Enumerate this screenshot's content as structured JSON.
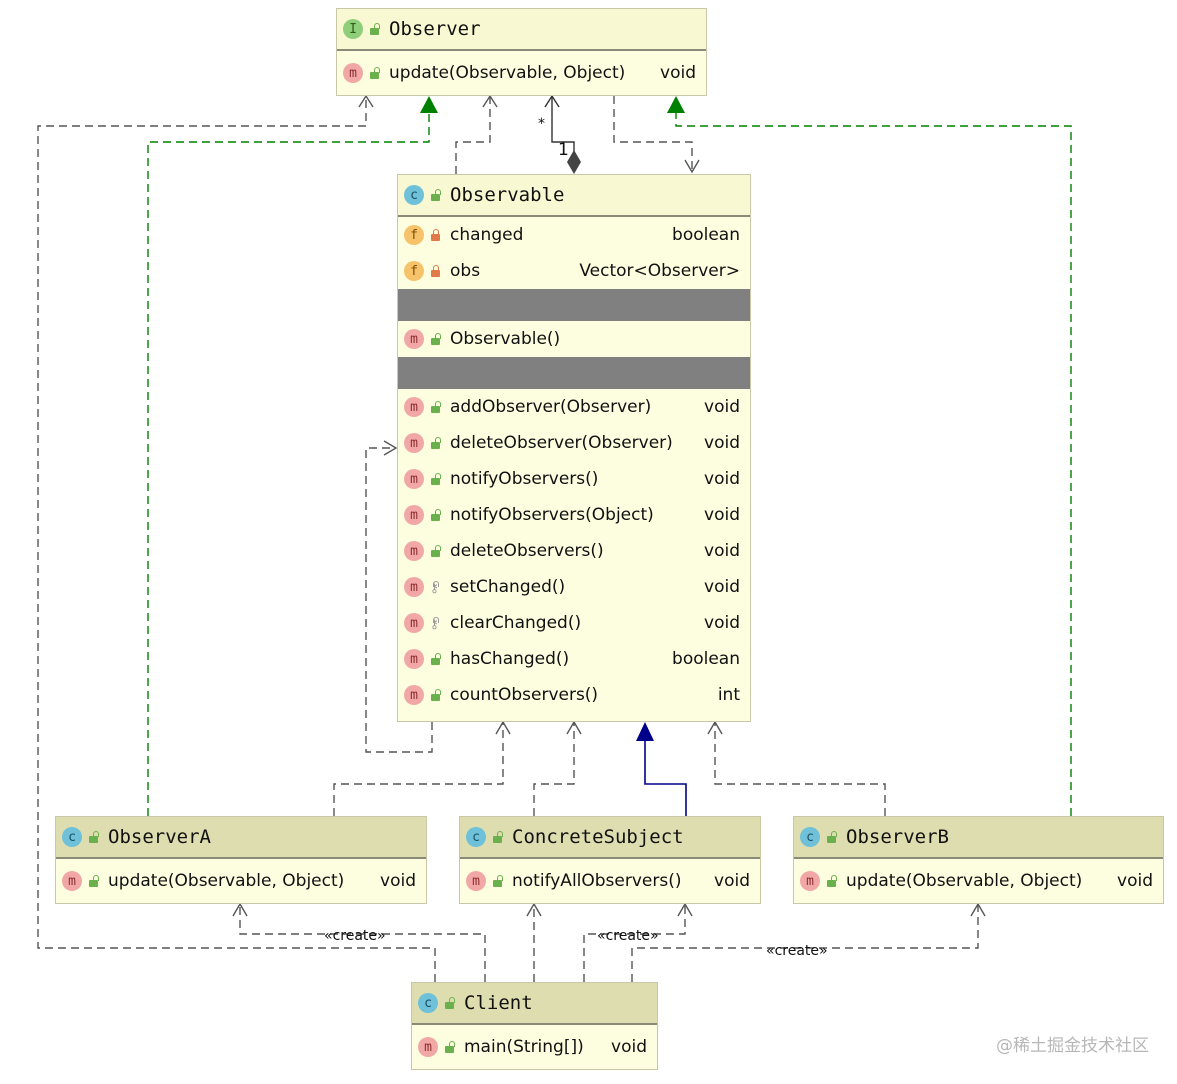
{
  "classes": {
    "observer": {
      "name": "Observer",
      "kind_icon": "I",
      "methods": [
        {
          "name": "update(Observable, Object)",
          "type": "void",
          "icon": "m",
          "visibility": "public"
        }
      ]
    },
    "observable": {
      "name": "Observable",
      "kind_icon": "c",
      "fields": [
        {
          "name": "changed",
          "type": "boolean",
          "icon": "f",
          "visibility": "private"
        },
        {
          "name": "obs",
          "type": "Vector<Observer>",
          "icon": "f",
          "visibility": "private"
        }
      ],
      "constructors": [
        {
          "name": "Observable()",
          "icon": "m",
          "visibility": "public"
        }
      ],
      "methods": [
        {
          "name": "addObserver(Observer)",
          "type": "void",
          "icon": "m",
          "visibility": "public"
        },
        {
          "name": "deleteObserver(Observer)",
          "type": "void",
          "icon": "m",
          "visibility": "public"
        },
        {
          "name": "notifyObservers()",
          "type": "void",
          "icon": "m",
          "visibility": "public"
        },
        {
          "name": "notifyObservers(Object)",
          "type": "void",
          "icon": "m",
          "visibility": "public"
        },
        {
          "name": "deleteObservers()",
          "type": "void",
          "icon": "m",
          "visibility": "public"
        },
        {
          "name": "setChanged()",
          "type": "void",
          "icon": "m",
          "visibility": "protected"
        },
        {
          "name": "clearChanged()",
          "type": "void",
          "icon": "m",
          "visibility": "protected"
        },
        {
          "name": "hasChanged()",
          "type": "boolean",
          "icon": "m",
          "visibility": "public"
        },
        {
          "name": "countObservers()",
          "type": "int",
          "icon": "m",
          "visibility": "public"
        }
      ]
    },
    "observer_a": {
      "name": "ObserverA",
      "kind_icon": "c",
      "methods": [
        {
          "name": "update(Observable, Object)",
          "type": "void",
          "icon": "m",
          "visibility": "public"
        }
      ]
    },
    "concrete_subject": {
      "name": "ConcreteSubject",
      "kind_icon": "c",
      "methods": [
        {
          "name": "notifyAllObservers()",
          "type": "void",
          "icon": "m",
          "visibility": "public"
        }
      ]
    },
    "observer_b": {
      "name": "ObserverB",
      "kind_icon": "c",
      "methods": [
        {
          "name": "update(Observable, Object)",
          "type": "void",
          "icon": "m",
          "visibility": "public"
        }
      ]
    },
    "client": {
      "name": "Client",
      "kind_icon": "c",
      "methods": [
        {
          "name": "main(String[])",
          "type": "void",
          "icon": "m",
          "visibility": "public"
        }
      ]
    }
  },
  "labels": {
    "multiplicity_many": "*",
    "multiplicity_one": "1",
    "create_1": "«create»",
    "create_2": "«create»",
    "create_3": "«create»"
  },
  "colors": {
    "realization": "#008000",
    "inheritance": "#00008b",
    "dependency": "#555555",
    "class_bg": "#fdfde0",
    "separator": "#808080"
  },
  "watermark": "@稀土掘金技术社区"
}
